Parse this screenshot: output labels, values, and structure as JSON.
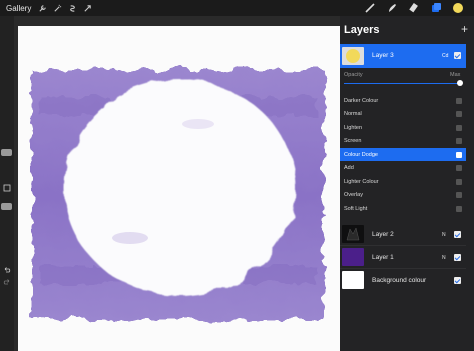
{
  "toolbar": {
    "gallery_label": "Gallery",
    "left_tools": [
      "wrench-icon",
      "magic-wand-icon",
      "selection-icon",
      "transform-icon"
    ],
    "right_tools": [
      "brush-icon",
      "smudge-icon",
      "eraser-icon",
      "layers-icon",
      "color-icon"
    ],
    "active_color": "#f2d95a",
    "accent": "#1d6cf0"
  },
  "layers_panel": {
    "title": "Layers",
    "add_label": "+",
    "active_layer": {
      "name": "Layer 3",
      "mode_tag": "Cd"
    },
    "opacity": {
      "label": "Opacity",
      "max_label": "Max",
      "value_fraction": 1.0
    },
    "blend_modes": [
      "Darker Colour",
      "Normal",
      "Lighten",
      "Screen",
      "Colour Dodge",
      "Add",
      "Lighter Colour",
      "Overlay",
      "Soft Light"
    ],
    "selected_blend_mode": "Colour Dodge",
    "layers": [
      {
        "name": "Layer 2",
        "mode_tag": "N"
      },
      {
        "name": "Layer 1",
        "mode_tag": "N"
      },
      {
        "name": "Background colour",
        "mode_tag": ""
      }
    ]
  }
}
